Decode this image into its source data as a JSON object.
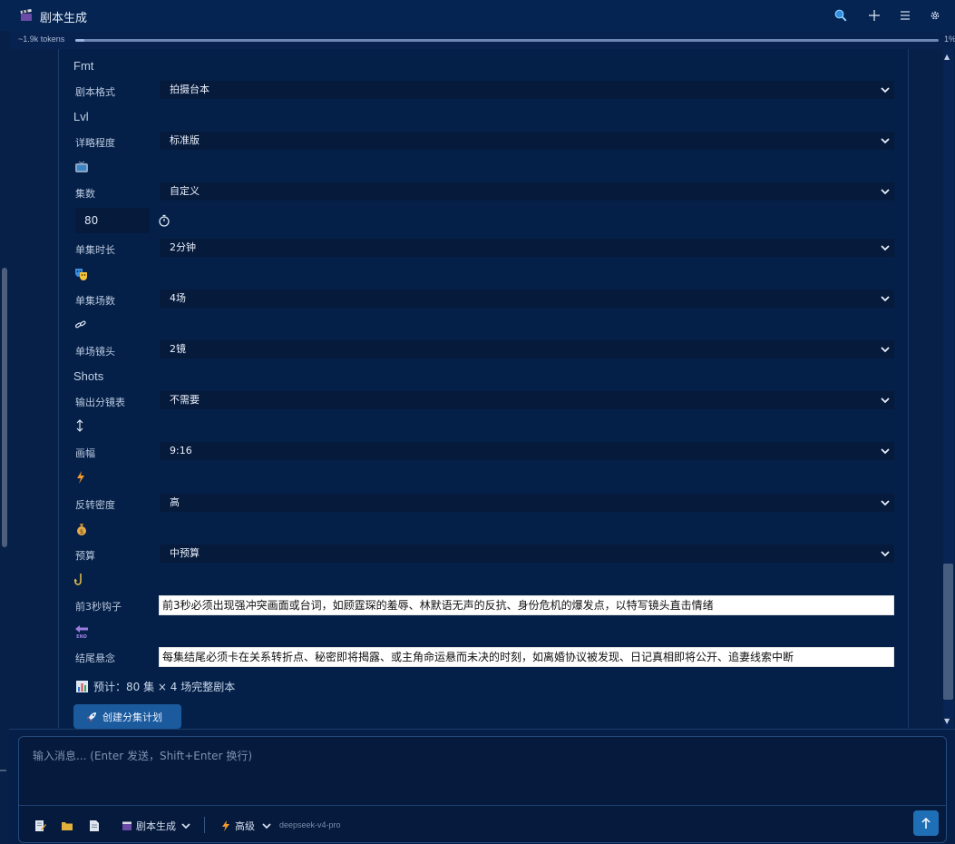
{
  "app": {
    "title": "剧本生成"
  },
  "tokens": {
    "label": "~1.9k tokens",
    "percent_text": "1%",
    "fill_fraction": 0.01
  },
  "form": {
    "sections": {
      "fmt": "Fmt",
      "lvl": "Lvl",
      "shots": "Shots"
    },
    "fields": {
      "format": {
        "label": "剧本格式",
        "value": "拍摄台本"
      },
      "detail": {
        "label": "详略程度",
        "value": "标准版"
      },
      "episodes": {
        "label": "集数",
        "value": "自定义"
      },
      "episode_count": {
        "value": "80"
      },
      "duration": {
        "label": "单集时长",
        "value": "2分钟"
      },
      "scenes": {
        "label": "单集场数",
        "value": "4场"
      },
      "shots_per_scene": {
        "label": "单场镜头",
        "value": "2镜"
      },
      "storyboard": {
        "label": "输出分镜表",
        "value": "不需要"
      },
      "aspect": {
        "label": "画幅",
        "value": "9:16"
      },
      "twist": {
        "label": "反转密度",
        "value": "高"
      },
      "budget": {
        "label": "预算",
        "value": "中预算"
      },
      "hook": {
        "label": "前3秒钩子",
        "value": "前3秒必须出现强冲突画面或台词，如顾霆琛的羞辱、林默语无声的反抗、身份危机的爆发点，以特写镜头直击情绪"
      },
      "cliffhanger": {
        "label": "结尾悬念",
        "value": "每集结尾必须卡在关系转折点、秘密即将揭露、或主角命运悬而未决的时刻，如离婚协议被发现、日记真相即将公开、追妻线索中断"
      }
    },
    "estimate": "预计：80 集 × 4 场完整剧本",
    "create_button": "创建分集计划"
  },
  "composer": {
    "placeholder": "输入消息... (Enter 发送，Shift+Enter 换行)",
    "mode_label": "剧本生成",
    "level_label": "高级",
    "model": "deepseek-v4-pro"
  },
  "icons": {
    "title": "clapperboard-icon",
    "search": "search-icon",
    "new": "plus-icon",
    "menu": "menu-icon",
    "settings": "gear-icon"
  },
  "colors": {
    "background": "#072047",
    "panel": "#042048",
    "select_bg": "#061a3c",
    "accent_button": "#1a5a9d",
    "send_button": "#1f6fb6"
  }
}
